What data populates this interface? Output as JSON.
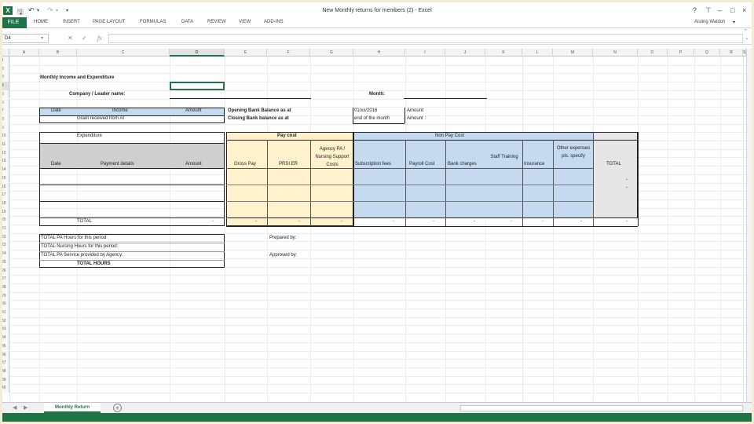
{
  "app": {
    "logo": "X",
    "title": "New Monthly returns for members (2) - Excel",
    "help": "?",
    "restore": "⊤",
    "minimize": "–",
    "maximize": "□",
    "close": "×",
    "user": "Aisling Waldon",
    "user_caret": "▾"
  },
  "quick_access": {
    "save": "🖫",
    "undo": "↶",
    "undo_caret": "▾",
    "redo": "↷",
    "redo_caret": "▾",
    "customize": "▾"
  },
  "ribbon": {
    "file": "FILE",
    "tabs": [
      "HOME",
      "INSERT",
      "PAGE LAYOUT",
      "FORMULAS",
      "DATA",
      "REVIEW",
      "VIEW",
      "ADD-INS"
    ],
    "collapse": "^"
  },
  "formula_bar": {
    "name_box": "D4",
    "name_caret": "▾",
    "cancel": "✕",
    "enter": "✓",
    "fx": "fx",
    "value": "",
    "expand": "⌄"
  },
  "columns": [
    "A",
    "B",
    "C",
    "D",
    "E",
    "F",
    "G",
    "H",
    "I",
    "J",
    "K",
    "L",
    "M",
    "N",
    "O",
    "P",
    "Q",
    "R",
    "S"
  ],
  "rows": [
    "1",
    "2",
    "3",
    "4",
    "5",
    "6",
    "7",
    "8",
    "9",
    "10",
    "11",
    "12",
    "13",
    "14",
    "15",
    "16",
    "17",
    "18",
    "19",
    "20",
    "21",
    "22",
    "23",
    "24",
    "25",
    "26",
    "27",
    "28",
    "29",
    "30",
    "31",
    "32",
    "33",
    "34",
    "35",
    "36",
    "37",
    "38",
    "39",
    "40"
  ],
  "sheet": {
    "title": "Monthly Income and Expenditure",
    "company_label": "Company / Leader name:",
    "month_label": "Month:",
    "income": {
      "headers": [
        "Date",
        "Income",
        "Amount"
      ],
      "row": "Grant received from AI"
    },
    "bank": {
      "opening": "Opening Bank Balance as at",
      "closing": "Closing Bank balance as at",
      "opening_date": "01/xx/2016",
      "closing_date": "end of the month",
      "opening_amount": "Amount:",
      "closing_amount": "Amount :"
    },
    "expenditure": {
      "title": "Expenditure",
      "pay_cost": "Pay cost",
      "non_pay_cost": "Non Pay Cost",
      "headers": [
        "Date",
        "Payment details",
        "Amount"
      ],
      "pay_headers": [
        "Gross Pay",
        "PRSI ER",
        "Agency PA / Nursing Support Costs"
      ],
      "nonpay_headers": [
        "Subscription fees",
        "Payroll Cost",
        "Bank charges",
        "Staff Training",
        "Insurance",
        "Other expenses pls. specify"
      ],
      "total_header": "TOTAL",
      "total_label": "TOTAL",
      "dash": "-"
    },
    "hours": {
      "pa": "TOTAL PA Hours for this period:",
      "nursing": "TOTAL Nursing Hours for this period:",
      "agency": "TOTAL PA Service provided by Agency:",
      "total": "TOTAL HOURS"
    },
    "prepared_by": "Prepared by:",
    "approved_by": "Approved by:"
  },
  "sheet_tabs": {
    "prev": "◀",
    "next": "▶",
    "active": "Monthly Return",
    "add": "+"
  }
}
